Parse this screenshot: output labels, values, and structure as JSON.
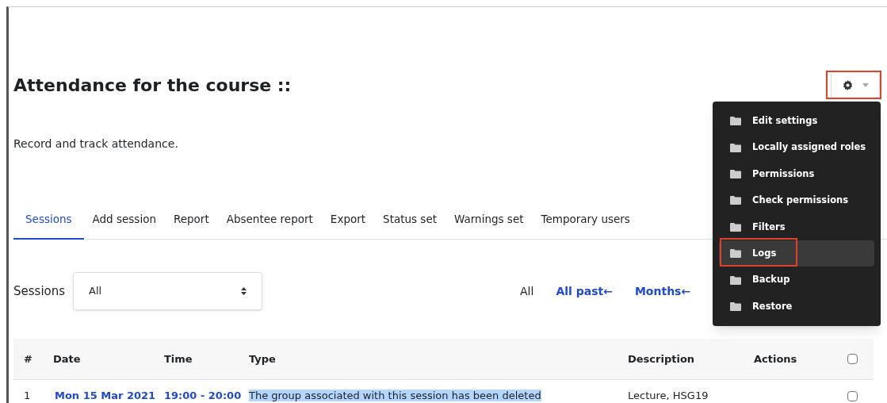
{
  "title": "Attendance for the course ::",
  "settings_button": {
    "annotated": true
  },
  "description": "Record and track attendance.",
  "tabs": [
    {
      "label": "Sessions",
      "selected": true
    },
    {
      "label": "Add session",
      "selected": false
    },
    {
      "label": "Report",
      "selected": false
    },
    {
      "label": "Absentee report",
      "selected": false
    },
    {
      "label": "Export",
      "selected": false
    },
    {
      "label": "Status set",
      "selected": false
    },
    {
      "label": "Warnings set",
      "selected": false
    },
    {
      "label": "Temporary users",
      "selected": false
    }
  ],
  "sessions_filter": {
    "label": "Sessions",
    "value": "All"
  },
  "view_links": [
    {
      "label": "All",
      "selected": true
    },
    {
      "label": "All past←",
      "selected": false
    },
    {
      "label": "Months←",
      "selected": false
    }
  ],
  "table": {
    "columns": [
      "#",
      "Date",
      "Time",
      "Type",
      "Description",
      "Actions"
    ],
    "header_checked": false,
    "rows": [
      {
        "number": "1",
        "date": "Mon 15 Mar 2021",
        "time": "19:00 - 20:00",
        "type": "The group associated with this session has been deleted",
        "type_highlighted": true,
        "description": "Lecture, HSG19",
        "checked": false
      }
    ]
  },
  "menu": {
    "items": [
      {
        "label": "Edit settings",
        "selected": false,
        "annotated": false
      },
      {
        "label": "Locally assigned roles",
        "selected": false,
        "annotated": false
      },
      {
        "label": "Permissions",
        "selected": false,
        "annotated": false
      },
      {
        "label": "Check permissions",
        "selected": false,
        "annotated": false
      },
      {
        "label": "Filters",
        "selected": false,
        "annotated": false
      },
      {
        "label": "Logs",
        "selected": true,
        "annotated": true
      },
      {
        "label": "Backup",
        "selected": false,
        "annotated": false
      },
      {
        "label": "Restore",
        "selected": false,
        "annotated": false
      }
    ]
  }
}
